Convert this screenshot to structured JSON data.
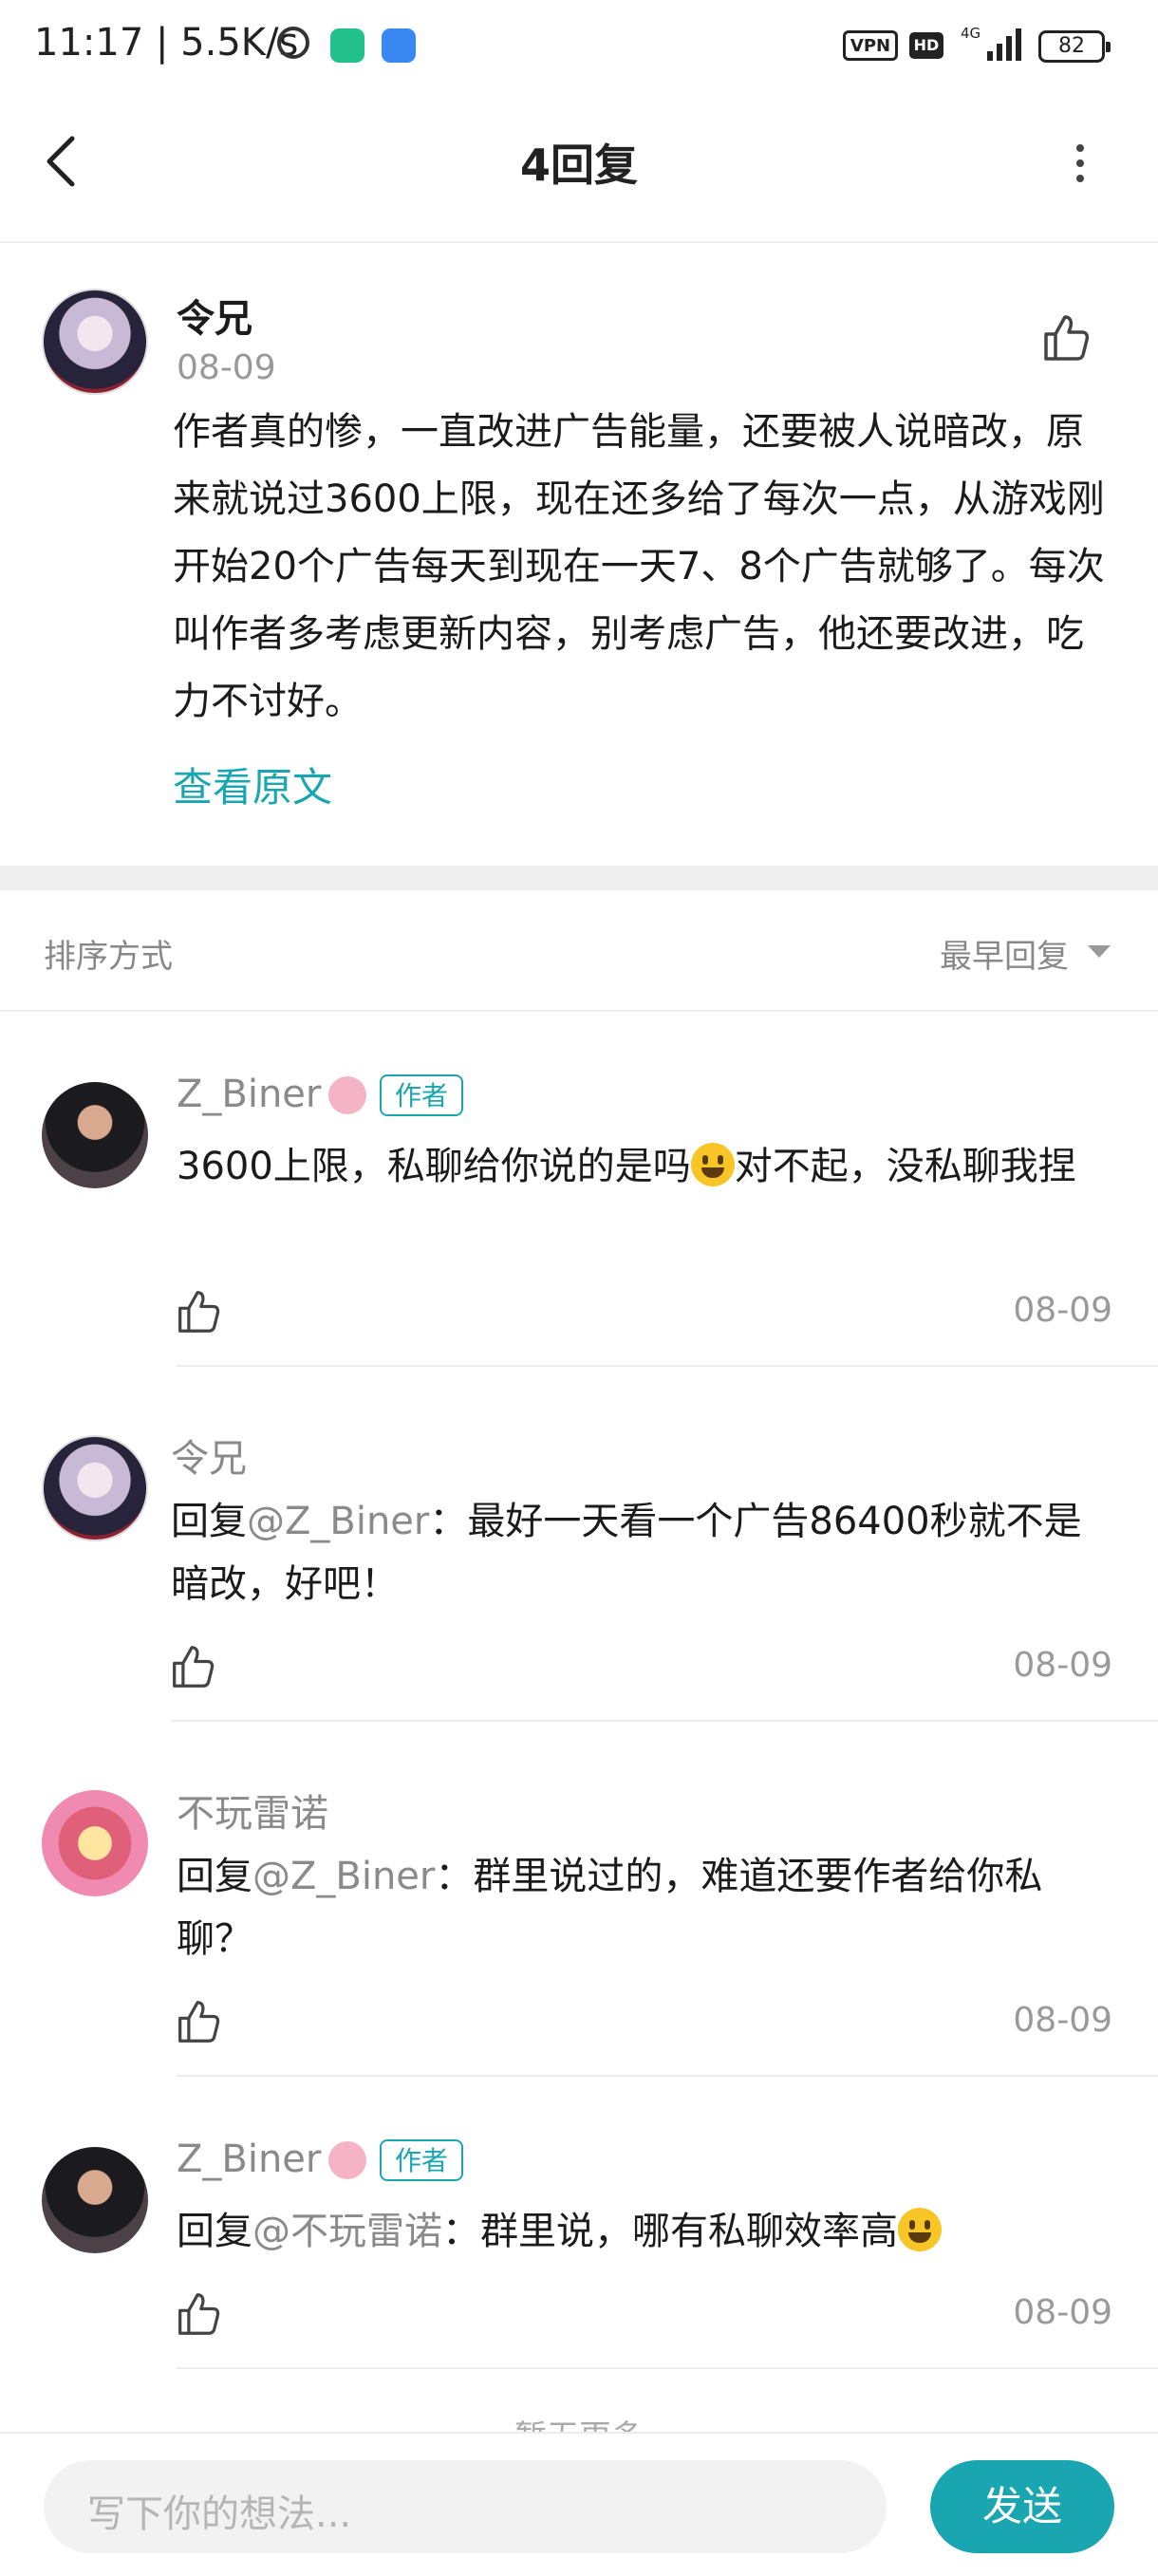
{
  "status_bar": {
    "time": "11:17 | 5.5K/s",
    "vpn": "VPN",
    "hd": "HD",
    "network": "4G",
    "battery": "82",
    "icons": [
      "alarm-icon",
      "shield-app-icon",
      "feather-app-icon",
      "signal-icon",
      "battery-icon"
    ]
  },
  "header": {
    "title": "4回复",
    "back_icon": "chevron-left-icon",
    "more_icon": "more-vertical-icon"
  },
  "main_comment": {
    "author": "令兄",
    "date": "08-09",
    "body": "作者真的惨，一直改进广告能量，还要被人说暗改，原来就说过3600上限，现在还多给了每次一点，从游戏刚开始20个广告每天到现在一天7、8个广告就够了。每次叫作者多考虑更新内容，别考虑广告，他还要改进，吃力不讨好。",
    "view_original": "查看原文"
  },
  "sort": {
    "label": "排序方式",
    "value": "最早回复"
  },
  "replies": [
    {
      "author": "Z_Biner",
      "badge": "作者",
      "body_before": "3600上限，私聊给你说的是吗",
      "body_after": "对不起，没私聊我捏",
      "date": "08-09"
    },
    {
      "author": "令兄",
      "reply_prefix": "回复",
      "reply_to": "@Z_Biner",
      "body": "：最好一天看一个广告86400秒就不是暗改，好吧！",
      "date": "08-09"
    },
    {
      "author": "不玩雷诺",
      "reply_prefix": "回复",
      "reply_to": "@Z_Biner",
      "body": "：群里说过的，难道还要作者给你私聊？",
      "date": "08-09"
    },
    {
      "author": "Z_Biner",
      "badge": "作者",
      "reply_prefix": "回复",
      "reply_to": "@不玩雷诺",
      "body": "：群里说，哪有私聊效率高",
      "date": "08-09"
    }
  ],
  "load_more": "暂无更多",
  "composer": {
    "placeholder": "写下你的想法...",
    "send": "发送"
  },
  "colors": {
    "accent": "#1aa6b1",
    "muted_text": "#999999",
    "body_text": "#1b1b1b"
  }
}
